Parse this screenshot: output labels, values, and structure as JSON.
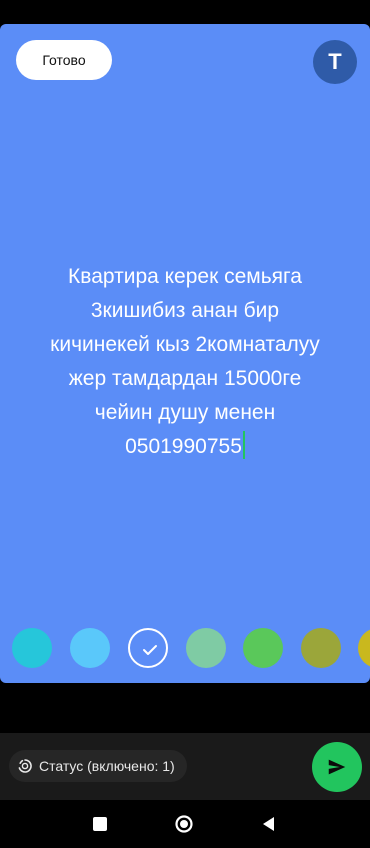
{
  "toolbar": {
    "done_label": "Готово",
    "text_tool_label": "T"
  },
  "status": {
    "lines": [
      "Квартира керек семьяга",
      "3кишибиз анан бир",
      "кичинекей кыз 2комнаталуу",
      "жер тамдардан 15000ге",
      "чейин душу менен",
      "0501990755"
    ],
    "background_color": "#5B8DF7",
    "text_color": "#FFFFFF",
    "caret_color": "#22C55E"
  },
  "palette": {
    "colors": [
      "#26C6DA",
      "#5AC8FA",
      "#5B8DF7",
      "#7FCBA4",
      "#5AC85A",
      "#9BA63A",
      "#C9B81E"
    ],
    "selected_index": 2,
    "selected_icon": "check-icon"
  },
  "composer": {
    "status_chip_label": "Статус (включено: 1)",
    "status_chip_icon": "status-ring-icon",
    "send_icon": "send-icon",
    "send_color": "#22C55E"
  },
  "navbar": {
    "buttons": [
      "recents-icon",
      "home-icon",
      "back-icon"
    ]
  }
}
